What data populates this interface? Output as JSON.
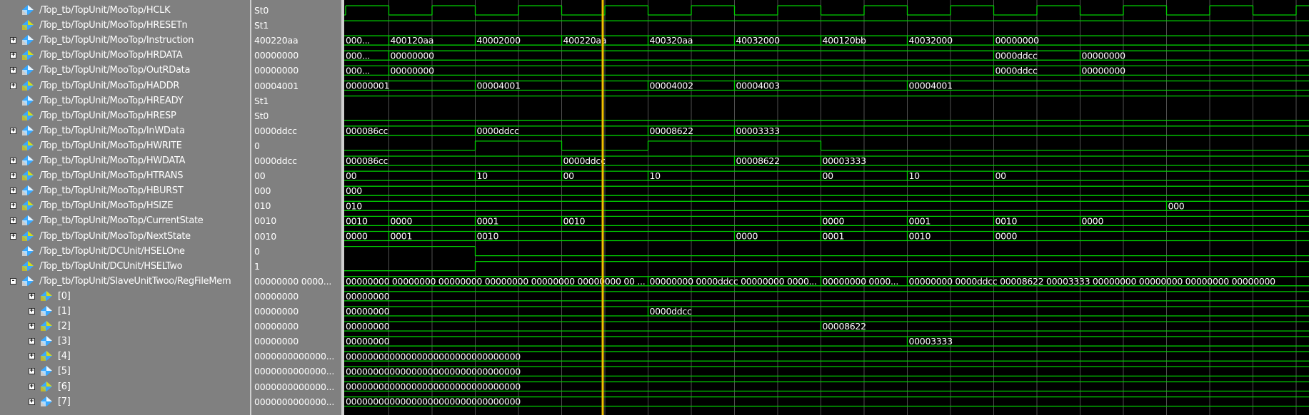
{
  "colors": {
    "wave": "#00d000",
    "cursor": "#f0c000",
    "grid": "#505050",
    "icon_blue": "#39a9ff",
    "icon_yellow": "#e8e000"
  },
  "signals": [
    {
      "name": "/Top_tb/TopUnit/MooTop/HCLK",
      "value": "St0",
      "expand": "",
      "icon": "signal-icon",
      "indent": 0
    },
    {
      "name": "/Top_tb/TopUnit/MooTop/HRESETn",
      "value": "St1",
      "expand": "",
      "icon": "signal-icon",
      "indent": 0
    },
    {
      "name": "/Top_tb/TopUnit/MooTop/Instruction",
      "value": "400220aa",
      "expand": "+",
      "icon": "signal-icon",
      "indent": 0
    },
    {
      "name": "/Top_tb/TopUnit/MooTop/HRDATA",
      "value": "00000000",
      "expand": "+",
      "icon": "signal-icon",
      "indent": 0
    },
    {
      "name": "/Top_tb/TopUnit/MooTop/OutRData",
      "value": "00000000",
      "expand": "+",
      "icon": "signal-icon",
      "indent": 0
    },
    {
      "name": "/Top_tb/TopUnit/MooTop/HADDR",
      "value": "00004001",
      "expand": "+",
      "icon": "signal-icon",
      "indent": 0
    },
    {
      "name": "/Top_tb/TopUnit/MooTop/HREADY",
      "value": "St1",
      "expand": "",
      "icon": "signal-icon",
      "indent": 0
    },
    {
      "name": "/Top_tb/TopUnit/MooTop/HRESP",
      "value": "St0",
      "expand": "",
      "icon": "signal-icon",
      "indent": 0
    },
    {
      "name": "/Top_tb/TopUnit/MooTop/InWData",
      "value": "0000ddcc",
      "expand": "+",
      "icon": "signal-icon",
      "indent": 0
    },
    {
      "name": "/Top_tb/TopUnit/MooTop/HWRITE",
      "value": "0",
      "expand": "",
      "icon": "signal-icon",
      "indent": 0
    },
    {
      "name": "/Top_tb/TopUnit/MooTop/HWDATA",
      "value": "0000ddcc",
      "expand": "+",
      "icon": "signal-icon",
      "indent": 0
    },
    {
      "name": "/Top_tb/TopUnit/MooTop/HTRANS",
      "value": "00",
      "expand": "+",
      "icon": "signal-icon",
      "indent": 0
    },
    {
      "name": "/Top_tb/TopUnit/MooTop/HBURST",
      "value": "000",
      "expand": "+",
      "icon": "signal-icon",
      "indent": 0
    },
    {
      "name": "/Top_tb/TopUnit/MooTop/HSIZE",
      "value": "010",
      "expand": "+",
      "icon": "signal-icon",
      "indent": 0
    },
    {
      "name": "/Top_tb/TopUnit/MooTop/CurrentState",
      "value": "0010",
      "expand": "+",
      "icon": "signal-icon",
      "indent": 0
    },
    {
      "name": "/Top_tb/TopUnit/MooTop/NextState",
      "value": "0010",
      "expand": "+",
      "icon": "signal-icon",
      "indent": 0
    },
    {
      "name": "/Top_tb/TopUnit/DCUnit/HSELOne",
      "value": "0",
      "expand": "",
      "icon": "signal-icon",
      "indent": 0
    },
    {
      "name": "/Top_tb/TopUnit/DCUnit/HSELTwo",
      "value": "1",
      "expand": "",
      "icon": "signal-icon",
      "indent": 0
    },
    {
      "name": "/Top_tb/TopUnit/SlaveUnitTwoo/RegFileMem",
      "value": "00000000 0000...",
      "expand": "-",
      "icon": "signal-icon",
      "indent": 0
    },
    {
      "name": "[0]",
      "value": "00000000",
      "expand": "+",
      "icon": "signal-icon",
      "indent": 1
    },
    {
      "name": "[1]",
      "value": "00000000",
      "expand": "+",
      "icon": "signal-icon",
      "indent": 1
    },
    {
      "name": "[2]",
      "value": "00000000",
      "expand": "+",
      "icon": "signal-icon",
      "indent": 1
    },
    {
      "name": "[3]",
      "value": "00000000",
      "expand": "+",
      "icon": "signal-icon",
      "indent": 1
    },
    {
      "name": "[4]",
      "value": "0000000000000...",
      "expand": "+",
      "icon": "signal-icon",
      "indent": 1
    },
    {
      "name": "[5]",
      "value": "0000000000000...",
      "expand": "+",
      "icon": "signal-icon",
      "indent": 1
    },
    {
      "name": "[6]",
      "value": "0000000000000...",
      "expand": "+",
      "icon": "signal-icon",
      "indent": 1
    },
    {
      "name": "[7]",
      "value": "0000000000000...",
      "expand": "+",
      "icon": "signal-icon",
      "indent": 1
    }
  ],
  "waves": [
    {
      "type": "clock"
    },
    {
      "type": "high"
    },
    {
      "type": "bus",
      "segs": [
        [
          "000...",
          0
        ],
        [
          "400120aa",
          1
        ],
        [
          "40002000",
          3
        ],
        [
          "400220aa",
          5
        ],
        [
          "400320aa",
          7
        ],
        [
          "40032000",
          9
        ],
        [
          "400120bb",
          11
        ],
        [
          "40032000",
          13
        ],
        [
          "00000000",
          15
        ]
      ]
    },
    {
      "type": "bus",
      "segs": [
        [
          "000...",
          0
        ],
        [
          "00000000",
          1
        ],
        [
          "0000ddcc",
          15
        ],
        [
          "00000000",
          17
        ]
      ]
    },
    {
      "type": "bus",
      "segs": [
        [
          "000...",
          0
        ],
        [
          "00000000",
          1
        ],
        [
          "0000ddcc",
          15
        ],
        [
          "00000000",
          17
        ]
      ]
    },
    {
      "type": "bus",
      "segs": [
        [
          "00000001",
          0
        ],
        [
          "00004001",
          3
        ],
        [
          "00004002",
          7
        ],
        [
          "00004003",
          9
        ],
        [
          "00004001",
          13
        ]
      ]
    },
    {
      "type": "high"
    },
    {
      "type": "low"
    },
    {
      "type": "bus",
      "segs": [
        [
          "000086cc",
          0
        ],
        [
          "0000ddcc",
          3
        ],
        [
          "00008622",
          7
        ],
        [
          "00003333",
          9
        ]
      ]
    },
    {
      "type": "bit",
      "edges": [
        [
          0,
          0
        ],
        [
          3,
          1
        ],
        [
          5,
          0
        ],
        [
          7,
          1
        ],
        [
          11,
          0
        ]
      ]
    },
    {
      "type": "bus",
      "segs": [
        [
          "000086cc",
          0
        ],
        [
          "0000ddcc",
          5
        ],
        [
          "00008622",
          9
        ],
        [
          "00003333",
          11
        ]
      ]
    },
    {
      "type": "bus",
      "segs": [
        [
          "00",
          0
        ],
        [
          "10",
          3
        ],
        [
          "00",
          5
        ],
        [
          "10",
          7
        ],
        [
          "00",
          11
        ],
        [
          "10",
          13
        ],
        [
          "00",
          15
        ]
      ]
    },
    {
      "type": "bus",
      "segs": [
        [
          "000",
          0
        ]
      ]
    },
    {
      "type": "bus",
      "segs": [
        [
          "010",
          0
        ],
        [
          "000",
          19
        ]
      ]
    },
    {
      "type": "bus",
      "segs": [
        [
          "0010",
          0
        ],
        [
          "0000",
          1
        ],
        [
          "0001",
          3
        ],
        [
          "0010",
          5
        ],
        [
          "0000",
          11
        ],
        [
          "0001",
          13
        ],
        [
          "0010",
          15
        ],
        [
          "0000",
          17
        ]
      ]
    },
    {
      "type": "bus",
      "segs": [
        [
          "0000",
          0
        ],
        [
          "0001",
          1
        ],
        [
          "0010",
          3
        ],
        [
          "0000",
          9
        ],
        [
          "0001",
          11
        ],
        [
          "0010",
          13
        ],
        [
          "0000",
          15
        ]
      ]
    },
    {
      "type": "bit",
      "edges": [
        [
          0,
          1
        ],
        [
          3,
          0
        ]
      ]
    },
    {
      "type": "bit",
      "edges": [
        [
          0,
          0
        ],
        [
          3,
          1
        ]
      ]
    },
    {
      "type": "bus",
      "segs": [
        [
          "00000000 00000000 00000000 00000000 00000000 00000000 00 ...",
          0
        ],
        [
          "00000000 0000ddcc 00000000 0000...",
          7
        ],
        [
          "00000000 0000...",
          11
        ],
        [
          "00000000 0000ddcc 00008622 00003333 00000000 00000000 00000000 00000000",
          13
        ]
      ]
    },
    {
      "type": "bus",
      "segs": [
        [
          "00000000",
          0
        ]
      ]
    },
    {
      "type": "bus",
      "segs": [
        [
          "00000000",
          0
        ],
        [
          "0000ddcc",
          7
        ]
      ]
    },
    {
      "type": "bus",
      "segs": [
        [
          "00000000",
          0
        ],
        [
          "00008622",
          11
        ]
      ]
    },
    {
      "type": "bus",
      "segs": [
        [
          "00000000",
          0
        ],
        [
          "00003333",
          13
        ]
      ]
    },
    {
      "type": "bus",
      "segs": [
        [
          "00000000000000000000000000000000",
          0
        ]
      ]
    },
    {
      "type": "bus",
      "segs": [
        [
          "00000000000000000000000000000000",
          0
        ]
      ]
    },
    {
      "type": "bus",
      "segs": [
        [
          "00000000000000000000000000000000",
          0
        ]
      ]
    },
    {
      "type": "bus",
      "segs": [
        [
          "00000000000000000000000000000000",
          0
        ]
      ]
    }
  ]
}
